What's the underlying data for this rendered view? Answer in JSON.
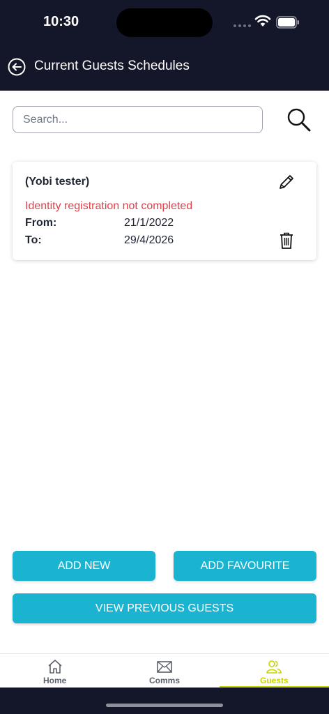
{
  "status_bar": {
    "time": "10:30"
  },
  "header": {
    "title": "Current Guests Schedules",
    "back_icon": "back-arrow-circle-icon"
  },
  "search": {
    "placeholder": "Search...",
    "value": "",
    "icon": "search-icon"
  },
  "guests": [
    {
      "name": "(Yobi tester)",
      "warning": "Identity registration not completed",
      "from_label": "From:",
      "from_value": "21/1/2022",
      "to_label": "To:",
      "to_value": "29/4/2026"
    }
  ],
  "actions": {
    "add_new": "ADD NEW",
    "add_favourite": "ADD FAVOURITE",
    "view_previous": "VIEW PREVIOUS GUESTS"
  },
  "tabs": [
    {
      "label": "Home",
      "icon": "home-icon",
      "active": false
    },
    {
      "label": "Comms",
      "icon": "mail-icon",
      "active": false
    },
    {
      "label": "Guests",
      "icon": "users-icon",
      "active": true
    }
  ],
  "colors": {
    "header_bg": "#141729",
    "accent_button": "#1ab4d1",
    "warning_text": "#e0404a",
    "active_tab": "#c9d400"
  }
}
